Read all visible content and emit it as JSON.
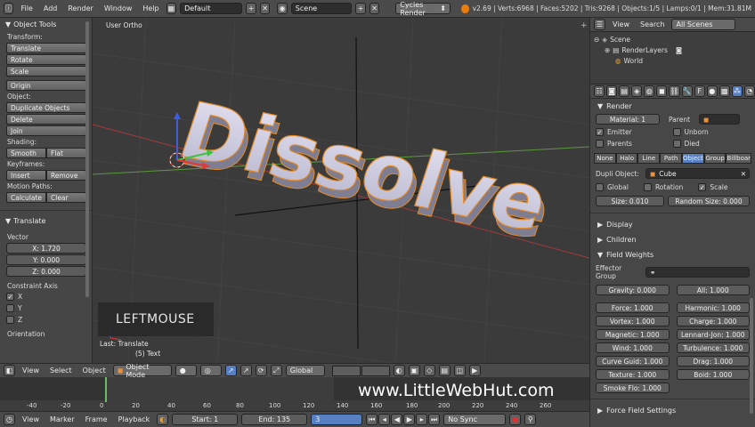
{
  "topbar": {
    "menus": [
      "File",
      "Add",
      "Render",
      "Window",
      "Help"
    ],
    "screen_layout": "Default",
    "scene": "Scene",
    "engine": "Cycles Render",
    "stats": "v2.69 | Verts:6968 | Faces:5202 | Tris:9268 | Objects:1/5 | Lamps:0/1 | Mem:31.81M"
  },
  "tool_panel": {
    "title": "Object Tools",
    "transform_label": "Transform:",
    "translate": "Translate",
    "rotate": "Rotate",
    "scale": "Scale",
    "origin": "Origin",
    "object_label": "Object:",
    "duplicate": "Duplicate Objects",
    "delete": "Delete",
    "join": "Join",
    "shading_label": "Shading:",
    "smooth": "Smooth",
    "flat": "Flat",
    "keyframes_label": "Keyframes:",
    "insert": "Insert",
    "remove": "Remove",
    "motion_label": "Motion Paths:",
    "calculate": "Calculate",
    "clear": "Clear",
    "op_title": "Translate",
    "vector_label": "Vector",
    "x": "X: 1.720",
    "y": "Y: 0.000",
    "z": "Z: 0.000",
    "constraint_label": "Constraint Axis",
    "cx": "X",
    "cy": "Y",
    "cz": "Z",
    "orientation_label": "Orientation"
  },
  "viewport": {
    "view_label": "User Ortho",
    "text3d": "Dissolve",
    "key_overlay": "LEFTMOUSE",
    "last_op": "Last: Translate",
    "object_info": "(5) Text"
  },
  "view_header": {
    "view": "View",
    "select": "Select",
    "object": "Object",
    "mode": "Object Mode",
    "orientation": "Global"
  },
  "timeline": {
    "ticks": [
      "-40",
      "-20",
      "0",
      "20",
      "40",
      "60",
      "80",
      "100",
      "120",
      "140",
      "160",
      "180",
      "200",
      "220",
      "240",
      "260"
    ],
    "current_frame": 1,
    "watermark": "www.LittleWebHut.com"
  },
  "timeline_header": {
    "view": "View",
    "marker": "Marker",
    "frame": "Frame",
    "playback": "Playback",
    "start": "Start: 1",
    "end": "End: 135",
    "current": "3",
    "sync": "No Sync"
  },
  "outliner": {
    "view": "View",
    "search": "Search",
    "filter": "All Scenes",
    "items": [
      "Scene",
      "RenderLayers",
      "World"
    ]
  },
  "properties": {
    "render_title": "Render",
    "material": "Material: 1",
    "parent": "Parent",
    "emitter": "Emitter",
    "unborn": "Unborn",
    "parents": "Parents",
    "died": "Died",
    "render_as": [
      "None",
      "Halo",
      "Line",
      "Path",
      "Object",
      "Group",
      "Billboar"
    ],
    "render_as_active": "Object",
    "dupli_label": "Dupli Object:",
    "dupli_value": "Cube",
    "global": "Global",
    "rotation": "Rotation",
    "scale": "Scale",
    "size": "Size: 0.010",
    "random_size": "Random Size: 0.000",
    "display_title": "Display",
    "children_title": "Children",
    "field_weights_title": "Field Weights",
    "effector_group": "Effector Group",
    "gravity": "Gravity: 0.000",
    "all": "All: 1.000",
    "weights": [
      "Force: 1.000",
      "Harmonic: 1.000",
      "Vortex: 1.000",
      "Charge: 1.000",
      "Magnetic: 1.000",
      "Lennard-Jon: 1.000",
      "Wind: 1.000",
      "Turbulence: 1.000",
      "Curve Guid: 1.000",
      "Drag: 1.000",
      "Texture: 1.000",
      "Boid: 1.000",
      "Smoke Flo: 1.000"
    ],
    "force_field_settings": "Force Field Settings"
  }
}
